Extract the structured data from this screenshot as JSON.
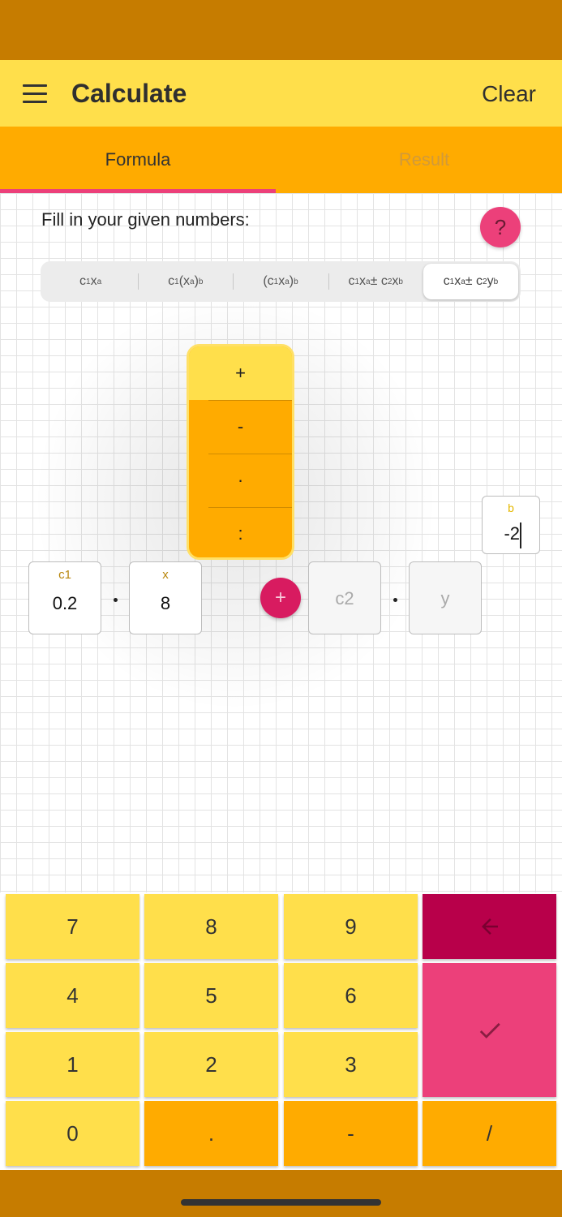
{
  "app_bar": {
    "title": "Calculate",
    "clear_label": "Clear"
  },
  "tabs": [
    {
      "label": "Formula",
      "selected": true
    },
    {
      "label": "Result",
      "selected": false
    }
  ],
  "content": {
    "instructions": "Fill in your given numbers:",
    "help_label": "?",
    "formula_selected_index": 4
  },
  "operator_picker": {
    "options": [
      "+",
      "-",
      "·",
      ":"
    ],
    "selected": "+"
  },
  "fields": {
    "c1": {
      "label": "c1",
      "value": "0.2"
    },
    "x": {
      "label": "x",
      "value": "8"
    },
    "operator_label": "+",
    "c2": {
      "placeholder": "c2"
    },
    "y": {
      "placeholder": "y"
    },
    "b": {
      "label": "b",
      "value": "-2"
    }
  },
  "keypad": {
    "keys": [
      "7",
      "8",
      "9",
      "4",
      "5",
      "6",
      "1",
      "2",
      "3",
      "0",
      ".",
      "-",
      "/"
    ],
    "backspace_icon": "arrow-left-icon",
    "confirm_icon": "check-icon"
  },
  "colors": {
    "status_bar": "#c67c00",
    "app_bar": "#ffdf4b",
    "tab_bar": "#ffab00",
    "accent_pink": "#ec407a",
    "accent_dark_pink": "#b8004a",
    "plus_button": "#d81b60"
  }
}
